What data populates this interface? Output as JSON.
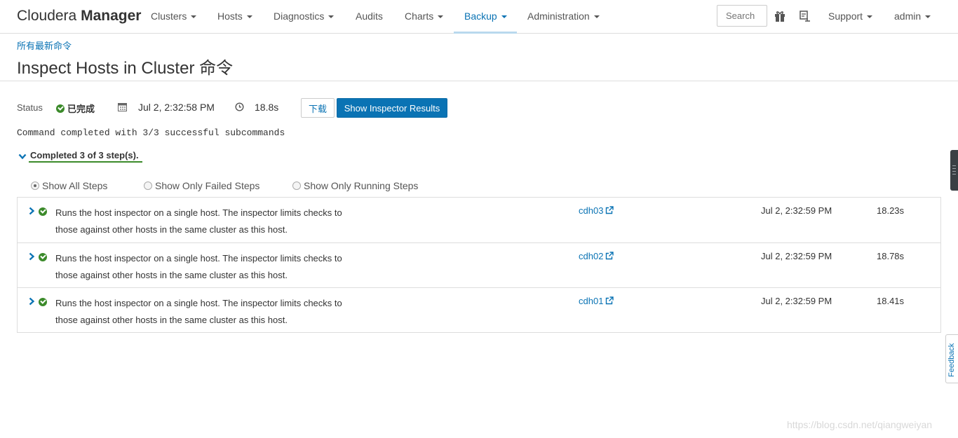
{
  "navbar": {
    "brand_light": "Cloudera",
    "brand_bold": "Manager",
    "items": [
      {
        "label": "Clusters"
      },
      {
        "label": "Hosts"
      },
      {
        "label": "Diagnostics"
      },
      {
        "label": "Audits"
      },
      {
        "label": "Charts"
      },
      {
        "label": "Backup"
      },
      {
        "label": "Administration"
      }
    ],
    "search_placeholder": "Search",
    "support_label": "Support",
    "user_label": "admin",
    "icons": [
      "gift-icon",
      "support-desk-icon"
    ]
  },
  "header": {
    "breadcrumb": "所有最新命令",
    "title": "Inspect Hosts in Cluster 命令"
  },
  "status": {
    "label": "Status",
    "value": "已完成",
    "start_time": "Jul 2, 2:32:58 PM",
    "duration": "18.8s",
    "download_label": "下载",
    "results_label": "Show Inspector Results"
  },
  "command_message": "Command completed with 3/3 successful subcommands",
  "steps_summary": "Completed 3 of 3 step(s).",
  "filters": {
    "all": "Show All Steps",
    "failed": "Show Only Failed Steps",
    "running": "Show Only Running Steps"
  },
  "steps": [
    {
      "desc_line1": "Runs the host inspector on a single host. The inspector limits checks to",
      "desc_line2": "those against other hosts in the same cluster as this host.",
      "host": "cdh03",
      "time": "Jul 2, 2:32:59 PM",
      "duration": "18.23s"
    },
    {
      "desc_line1": "Runs the host inspector on a single host. The inspector limits checks to",
      "desc_line2": "those against other hosts in the same cluster as this host.",
      "host": "cdh02",
      "time": "Jul 2, 2:32:59 PM",
      "duration": "18.78s"
    },
    {
      "desc_line1": "Runs the host inspector on a single host. The inspector limits checks to",
      "desc_line2": "those against other hosts in the same cluster as this host.",
      "host": "cdh01",
      "time": "Jul 2, 2:32:59 PM",
      "duration": "18.41s"
    }
  ],
  "feedback_label": "Feedback",
  "watermark": "https://blog.csdn.net/qiangweiyan",
  "colors": {
    "accent": "#0a73b4",
    "success": "#3b8a2a"
  }
}
